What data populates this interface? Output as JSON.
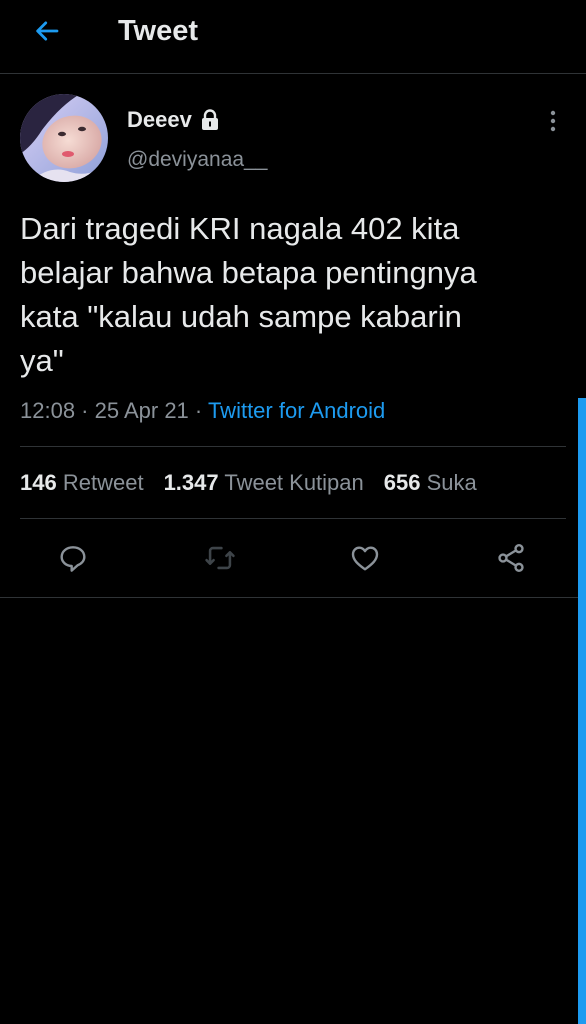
{
  "header": {
    "title": "Tweet",
    "back_icon": "arrow-left-icon"
  },
  "author": {
    "display_name": "Deeev",
    "handle": "@deviyanaa__",
    "protected_icon": "lock-icon"
  },
  "tweet": {
    "text": "Dari tragedi KRI nagala 402 kita\nbelajar bahwa betapa pentingnya\nkata \"kalau udah sampe kabarin\nya\"",
    "time": "12:08 · 25 Apr 21",
    "separator": " · ",
    "source": "Twitter for Android"
  },
  "stats": {
    "retweets_count": "146",
    "retweets_label": "Retweet",
    "quotes_count": "1.347",
    "quotes_label": "Tweet Kutipan",
    "likes_count": "656",
    "likes_label": "Suka"
  },
  "actions": [
    "reply-icon",
    "retweet-icon",
    "like-icon",
    "share-icon"
  ],
  "colors": {
    "background": "#000000",
    "accent": "#1d9bf0",
    "text_primary": "#e7e9ea",
    "text_secondary": "#8b9299",
    "divider": "#2f3336"
  }
}
